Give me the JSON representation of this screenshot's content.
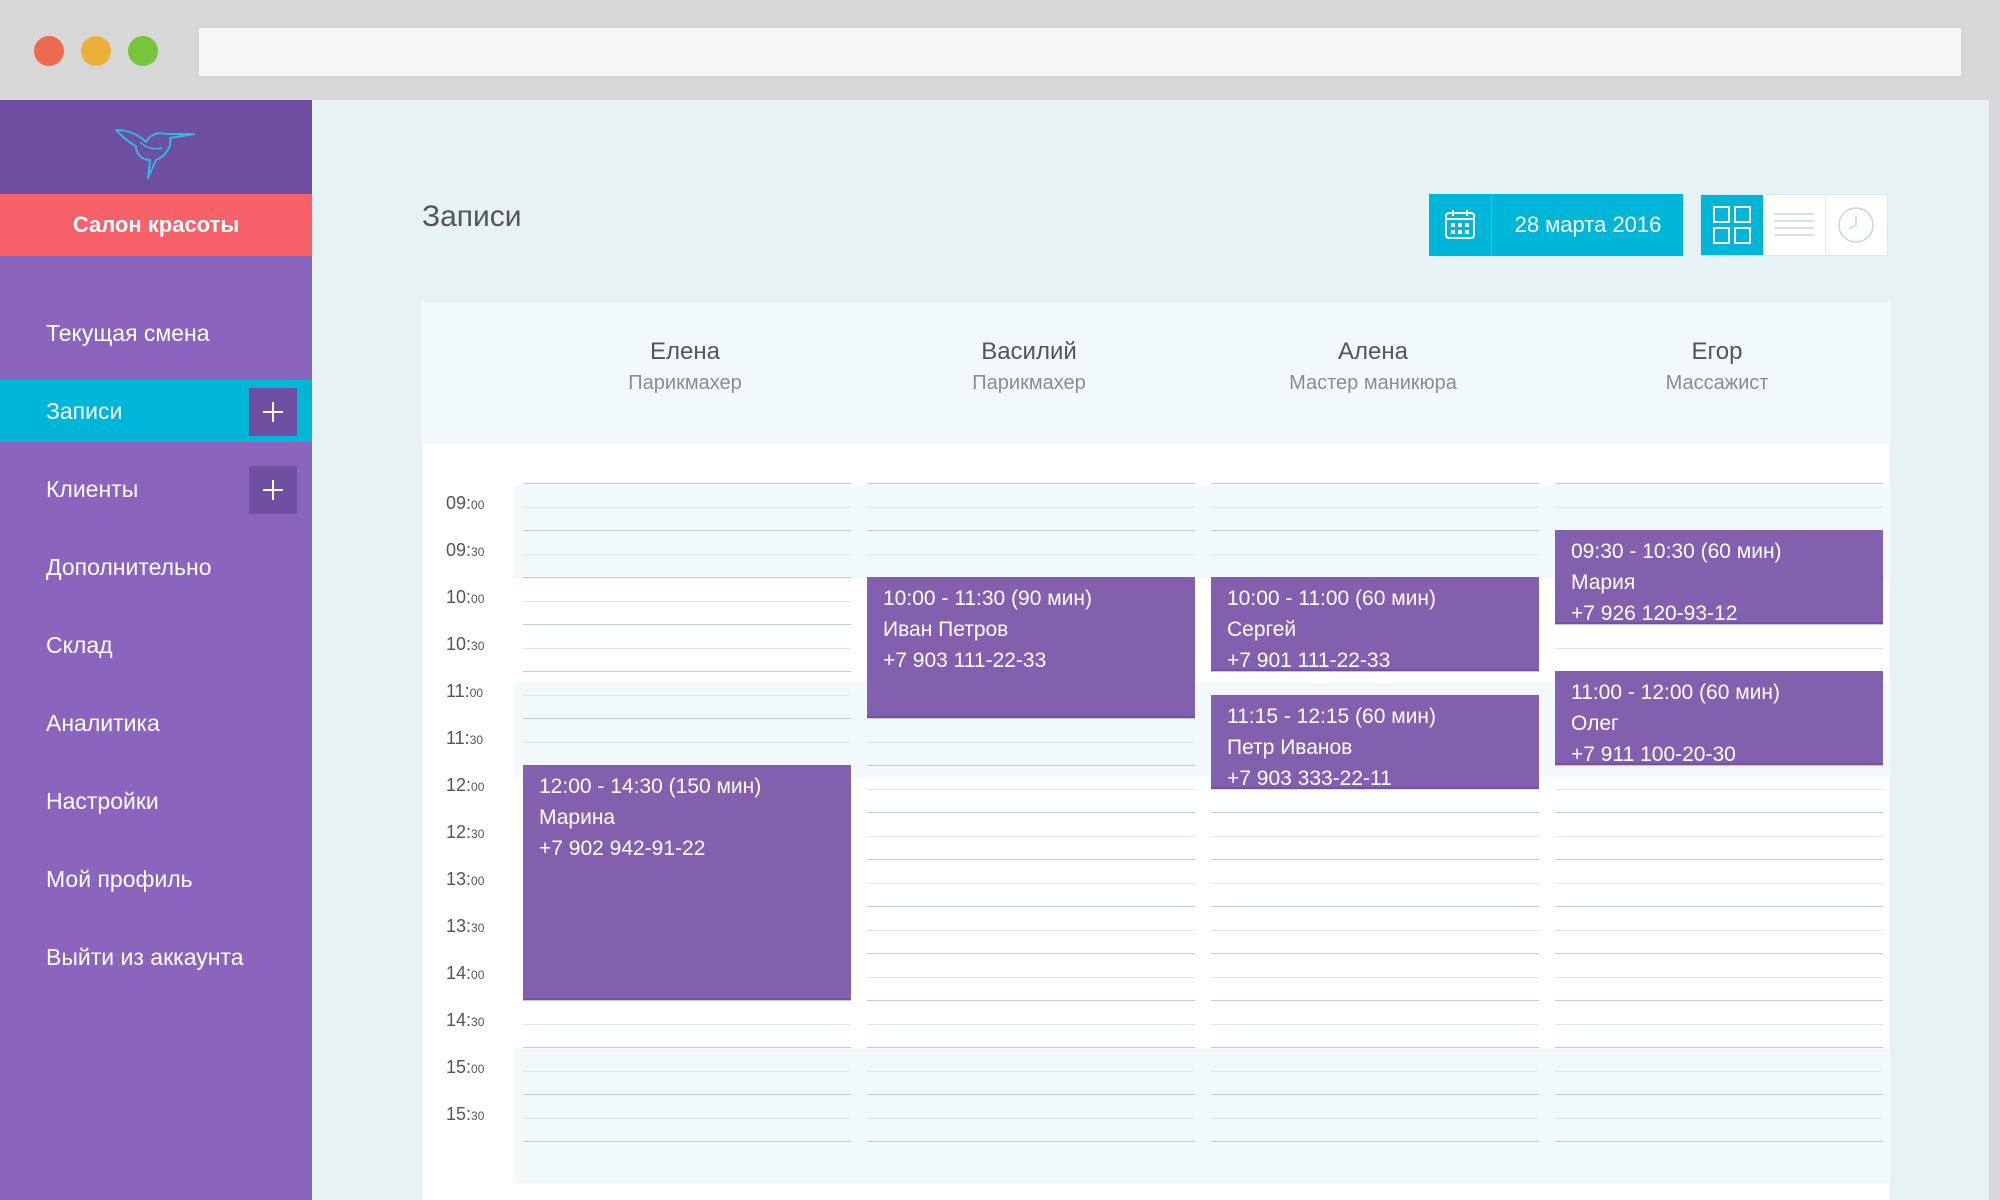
{
  "sidebar": {
    "salon_name": "Салон красоты",
    "items": [
      {
        "label": "Текущая смена"
      },
      {
        "label": "Записи",
        "active": true,
        "has_add": true
      },
      {
        "label": "Клиенты",
        "has_add": true
      },
      {
        "label": "Дополнительно"
      },
      {
        "label": "Склад"
      },
      {
        "label": "Аналитика"
      },
      {
        "label": "Настройки"
      },
      {
        "label": "Мой профиль"
      },
      {
        "label": "Выйти из аккаунта"
      }
    ]
  },
  "header": {
    "title": "Записи",
    "date": "28 марта 2016",
    "calendar_icon": "calendar-icon",
    "views": [
      "grid-view-icon",
      "list-view-icon",
      "clock-icon"
    ]
  },
  "staff": [
    {
      "name": "Елена",
      "role": "Парикмахер"
    },
    {
      "name": "Василий",
      "role": "Парикмахер"
    },
    {
      "name": "Алена",
      "role": "Мастер маникюра"
    },
    {
      "name": "Егор",
      "role": "Массажист"
    }
  ],
  "times": [
    {
      "h": "09:",
      "m": "00"
    },
    {
      "h": "09:",
      "m": "30"
    },
    {
      "h": "10:",
      "m": "00"
    },
    {
      "h": "10:",
      "m": "30"
    },
    {
      "h": "11:",
      "m": "00"
    },
    {
      "h": "11:",
      "m": "30"
    },
    {
      "h": "12:",
      "m": "00"
    },
    {
      "h": "12:",
      "m": "30"
    },
    {
      "h": "13:",
      "m": "00"
    },
    {
      "h": "13:",
      "m": "30"
    },
    {
      "h": "14:",
      "m": "00"
    },
    {
      "h": "14:",
      "m": "30"
    },
    {
      "h": "15:",
      "m": "00"
    },
    {
      "h": "15:",
      "m": "30"
    }
  ],
  "appointments": [
    {
      "column": 0,
      "time": "12:00 - 14:30 (150 мин)",
      "client": "Марина",
      "phone": "+7 902 942-91-22"
    },
    {
      "column": 1,
      "time": "10:00 - 11:30 (90 мин)",
      "client": "Иван Петров",
      "phone": "+7 903 111-22-33"
    },
    {
      "column": 2,
      "time": "10:00 - 11:00 (60 мин)",
      "client": "Сергей",
      "phone": "+7 901 111-22-33"
    },
    {
      "column": 2,
      "time": "11:15 - 12:15 (60 мин)",
      "client": "Петр Иванов",
      "phone": "+7 903 333-22-11"
    },
    {
      "column": 3,
      "time": "09:30 - 10:30 (60 мин)",
      "client": "Мария",
      "phone": "+7 926 120-93-12"
    },
    {
      "column": 3,
      "time": "11:00 - 12:00 (60 мин)",
      "client": "Олег",
      "phone": "+7 911 100-20-30"
    }
  ],
  "colors": {
    "sidebar": "#8a64bd",
    "sidebar_dark": "#6f4fa1",
    "salon": "#f8606a",
    "accent": "#00b6d8",
    "appointment": "#8260ae"
  }
}
